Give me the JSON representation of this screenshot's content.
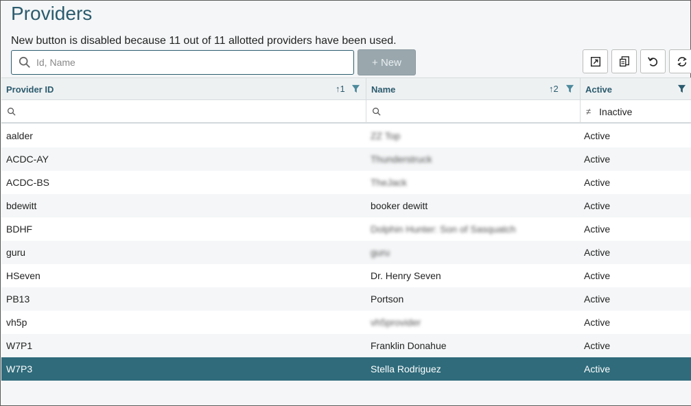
{
  "page": {
    "title": "Providers",
    "notice": "New button is disabled because  11 out of 11 allotted providers have been used."
  },
  "search": {
    "placeholder": "Id, Name",
    "value": ""
  },
  "new_button": {
    "label": "+ New",
    "enabled": false
  },
  "toolbar": {
    "buttons": [
      {
        "icon": "export-icon"
      },
      {
        "icon": "columns-icon"
      },
      {
        "icon": "undo-icon"
      },
      {
        "icon": "refresh-icon"
      }
    ]
  },
  "grid": {
    "columns": [
      {
        "label": "Provider ID",
        "sort": "↑1",
        "filter": true
      },
      {
        "label": "Name",
        "sort": "↑2",
        "filter": true
      },
      {
        "label": "Active",
        "sort": "",
        "filter": true
      }
    ],
    "filters": {
      "active_operator": "≠",
      "active_value": "Inactive"
    },
    "rows": [
      {
        "id": "aalder",
        "name": "ZZ Top",
        "name_blurred": true,
        "active": "Active"
      },
      {
        "id": "ACDC-AY",
        "name": "Thunderstruck",
        "name_blurred": true,
        "active": "Active"
      },
      {
        "id": "ACDC-BS",
        "name": "TheJack",
        "name_blurred": true,
        "active": "Active"
      },
      {
        "id": "bdewitt",
        "name": "booker dewitt",
        "name_blurred": false,
        "active": "Active"
      },
      {
        "id": "BDHF",
        "name": "Dolphin Hunter: Son of Sasquatch",
        "name_blurred": true,
        "active": "Active"
      },
      {
        "id": "guru",
        "name": "guru",
        "name_blurred": true,
        "active": "Active"
      },
      {
        "id": "HSeven",
        "name": "Dr. Henry Seven",
        "name_blurred": false,
        "active": "Active"
      },
      {
        "id": "PB13",
        "name": "Portson",
        "name_blurred": false,
        "active": "Active"
      },
      {
        "id": "vh5p",
        "name": "vh5provider",
        "name_blurred": true,
        "active": "Active"
      },
      {
        "id": "W7P1",
        "name": "Franklin Donahue",
        "name_blurred": false,
        "active": "Active"
      },
      {
        "id": "W7P3",
        "name": "Stella Rodriguez",
        "name_blurred": false,
        "active": "Active",
        "selected": true
      }
    ]
  },
  "colors": {
    "accent": "#2b5b6e",
    "selected_row": "#2f6b7b",
    "disabled_button": "#9aa8ae"
  }
}
